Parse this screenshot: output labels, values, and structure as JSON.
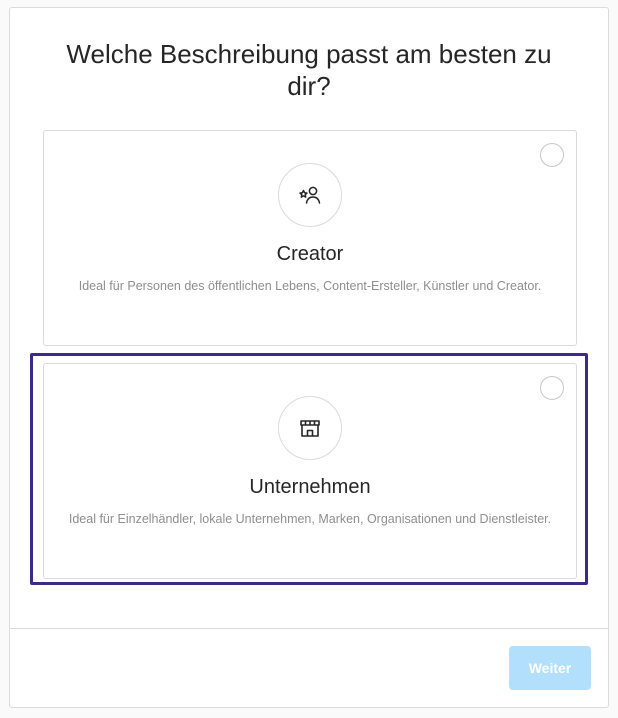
{
  "dialog": {
    "title": "Welche Beschreibung passt am besten zu dir?"
  },
  "options": [
    {
      "icon": "creator-star-person-icon",
      "label": "Creator",
      "description": "Ideal für Personen des öffentlichen Lebens, Content-Ersteller, Künstler und Creator.",
      "selected": false
    },
    {
      "icon": "storefront-icon",
      "label": "Unternehmen",
      "description": "Ideal für Einzelhändler, lokale Unternehmen, Marken, Organisationen und Dienstleister.",
      "selected": false
    }
  ],
  "footer": {
    "next_label": "Weiter",
    "next_enabled": false
  },
  "colors": {
    "next_button_disabled": "#b2dffc",
    "highlight": "#3d2a84",
    "text_primary": "#262626",
    "text_secondary": "#8e8e8e",
    "border": "#dbdbdb"
  }
}
